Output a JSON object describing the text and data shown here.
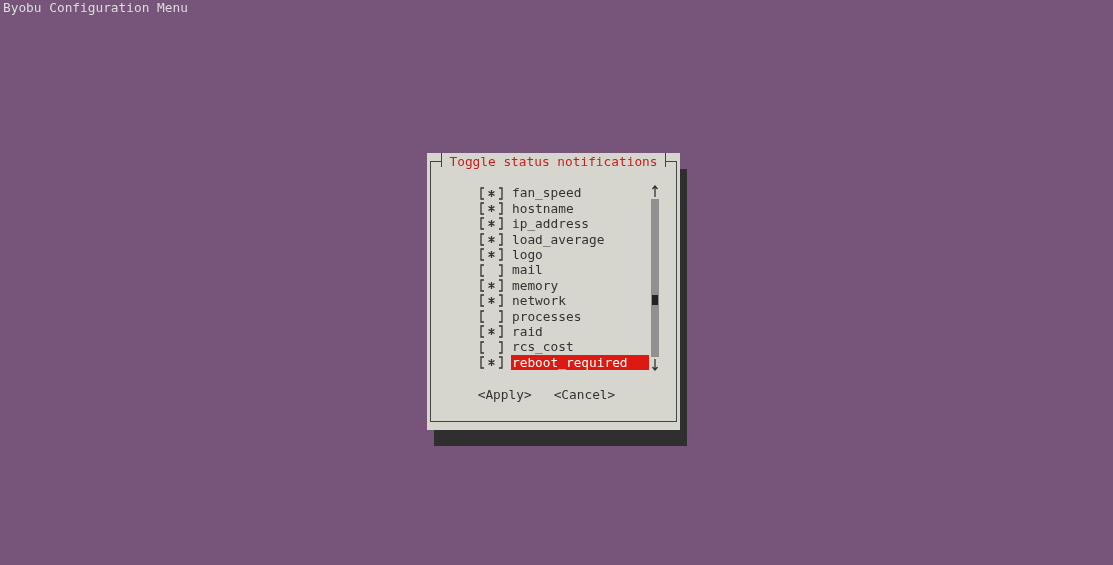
{
  "window": {
    "title": "Byobu Configuration Menu"
  },
  "dialog": {
    "title": "Toggle status notifications",
    "items": [
      {
        "label": "fan_speed",
        "checked": true,
        "selected": false
      },
      {
        "label": "hostname",
        "checked": true,
        "selected": false
      },
      {
        "label": "ip_address",
        "checked": true,
        "selected": false
      },
      {
        "label": "load_average",
        "checked": true,
        "selected": false
      },
      {
        "label": "logo",
        "checked": true,
        "selected": false
      },
      {
        "label": "mail",
        "checked": false,
        "selected": false
      },
      {
        "label": "memory",
        "checked": true,
        "selected": false
      },
      {
        "label": "network",
        "checked": true,
        "selected": false
      },
      {
        "label": "processes",
        "checked": false,
        "selected": false
      },
      {
        "label": "raid",
        "checked": true,
        "selected": false
      },
      {
        "label": "rcs_cost",
        "checked": false,
        "selected": false
      },
      {
        "label": "reboot_required",
        "checked": true,
        "selected": true
      }
    ],
    "buttons": [
      "<Apply>",
      "<Cancel>"
    ]
  }
}
